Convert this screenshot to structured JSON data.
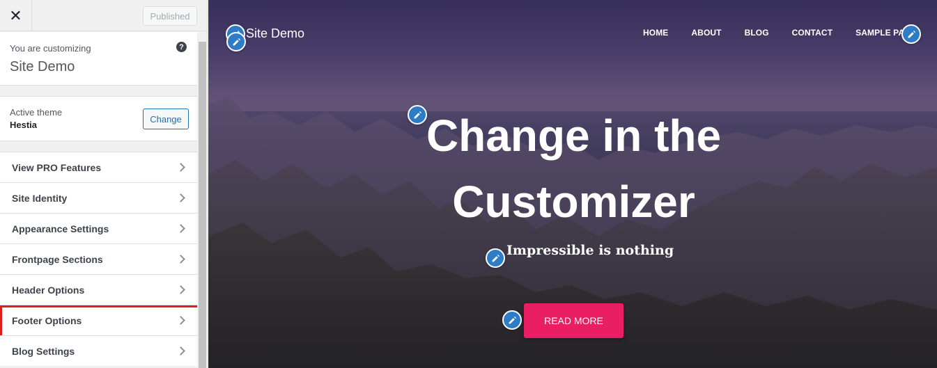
{
  "sidebar": {
    "close_icon": "close-icon",
    "published_label": "Published",
    "customizing_label": "You are customizing",
    "site_name": "Site Demo",
    "help_icon": "help-icon",
    "help_glyph": "?",
    "active_theme_label": "Active theme",
    "active_theme_name": "Hestia",
    "change_label": "Change",
    "menu_items": [
      {
        "label": "View PRO Features"
      },
      {
        "label": "Site Identity"
      },
      {
        "label": "Appearance Settings"
      },
      {
        "label": "Frontpage Sections"
      },
      {
        "label": "Header Options"
      },
      {
        "label": "Footer Options",
        "highlighted": true
      },
      {
        "label": "Blog Settings"
      }
    ],
    "highlight_color": "#e11d1d"
  },
  "preview": {
    "site_title": "Site Demo",
    "nav": [
      "HOME",
      "ABOUT",
      "BLOG",
      "CONTACT",
      "SAMPLE PAGE"
    ],
    "hero_title": "Change in the Customizer",
    "hero_subtitle": "Impressible is nothing",
    "button_label": "READ MORE",
    "button_color": "#e91e63",
    "edit_icon_color": "#2e7bc6",
    "edit_icon_name": "pencil-icon"
  }
}
